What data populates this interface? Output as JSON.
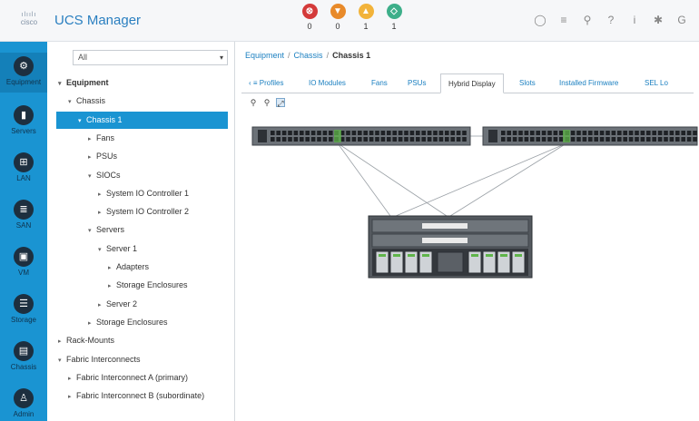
{
  "app": {
    "brand_bars": "ılıılı",
    "brand_word": "cisco",
    "title": "UCS Manager"
  },
  "faults": [
    {
      "icon": "critical-fault-icon",
      "glyph": "⊗",
      "color": "#d43a3a",
      "count": "0"
    },
    {
      "icon": "major-fault-icon",
      "glyph": "▼",
      "color": "#e88a2a",
      "count": "0"
    },
    {
      "icon": "minor-fault-icon",
      "glyph": "▲",
      "color": "#f2b33a",
      "count": "1"
    },
    {
      "icon": "warning-fault-icon",
      "glyph": "◇",
      "color": "#3daf8a",
      "count": "1"
    }
  ],
  "toolbar": [
    {
      "icon": "status-circle-icon",
      "glyph": "◯"
    },
    {
      "icon": "menu-icon",
      "glyph": "≡"
    },
    {
      "icon": "search-icon",
      "glyph": "⚲"
    },
    {
      "icon": "help-icon",
      "glyph": "?"
    },
    {
      "icon": "info-icon",
      "glyph": "i"
    },
    {
      "icon": "gear-icon",
      "glyph": "✱"
    },
    {
      "icon": "logout-icon",
      "glyph": "G"
    }
  ],
  "nav": [
    {
      "icon": "equipment-icon",
      "glyph": "⚙",
      "label": "Equipment",
      "active": true
    },
    {
      "icon": "servers-icon",
      "glyph": "▮",
      "label": "Servers"
    },
    {
      "icon": "lan-icon",
      "glyph": "⊞",
      "label": "LAN"
    },
    {
      "icon": "san-icon",
      "glyph": "≣",
      "label": "SAN"
    },
    {
      "icon": "vm-icon",
      "glyph": "▣",
      "label": "VM"
    },
    {
      "icon": "storage-icon",
      "glyph": "☰",
      "label": "Storage"
    },
    {
      "icon": "chassis-icon",
      "glyph": "▤",
      "label": "Chassis"
    },
    {
      "icon": "admin-icon",
      "glyph": "♙",
      "label": "Admin"
    }
  ],
  "filter": {
    "value": "All"
  },
  "tree": [
    {
      "label": "Equipment",
      "toggle": "▾",
      "indent": 0,
      "bold": true
    },
    {
      "label": "Chassis",
      "toggle": "▾",
      "indent": 1
    },
    {
      "label": "Chassis 1",
      "toggle": "▾",
      "indent": 2,
      "selected": true
    },
    {
      "label": "Fans",
      "toggle": "▸",
      "indent": 3
    },
    {
      "label": "PSUs",
      "toggle": "▸",
      "indent": 3
    },
    {
      "label": "SIOCs",
      "toggle": "▾",
      "indent": 3
    },
    {
      "label": "System IO Controller 1",
      "toggle": "▸",
      "indent": 4
    },
    {
      "label": "System IO Controller 2",
      "toggle": "▸",
      "indent": 4
    },
    {
      "label": "Servers",
      "toggle": "▾",
      "indent": 3
    },
    {
      "label": "Server 1",
      "toggle": "▾",
      "indent": 4
    },
    {
      "label": "Adapters",
      "toggle": "▸",
      "indent": 5
    },
    {
      "label": "Storage Enclosures",
      "toggle": "▸",
      "indent": 5
    },
    {
      "label": "Server 2",
      "toggle": "▸",
      "indent": 4
    },
    {
      "label": "Storage Enclosures",
      "toggle": "▸",
      "indent": 3
    },
    {
      "label": "Rack-Mounts",
      "toggle": "▸",
      "indent": 0
    },
    {
      "label": "Fabric Interconnects",
      "toggle": "▾",
      "indent": 0
    },
    {
      "label": "Fabric Interconnect A (primary)",
      "toggle": "▸",
      "indent": 1
    },
    {
      "label": "Fabric Interconnect B (subordinate)",
      "toggle": "▸",
      "indent": 1
    }
  ],
  "breadcrumb": {
    "items": [
      "Equipment",
      "Chassis"
    ],
    "current": "Chassis 1",
    "separator": "/"
  },
  "tabs": [
    {
      "label": "‹ ≡ Profiles"
    },
    {
      "label": "IO Modules"
    },
    {
      "label": "Fans"
    },
    {
      "label": "PSUs"
    },
    {
      "label": "Hybrid Display",
      "active": true
    },
    {
      "label": "Slots"
    },
    {
      "label": "Installed Firmware"
    },
    {
      "label": "SEL Lo"
    }
  ],
  "zoom_tools": [
    {
      "icon": "zoom-in-icon",
      "glyph": "⚲"
    },
    {
      "icon": "zoom-out-icon",
      "glyph": "⚲"
    },
    {
      "icon": "fit-to-screen-icon",
      "glyph": "⤢"
    }
  ]
}
